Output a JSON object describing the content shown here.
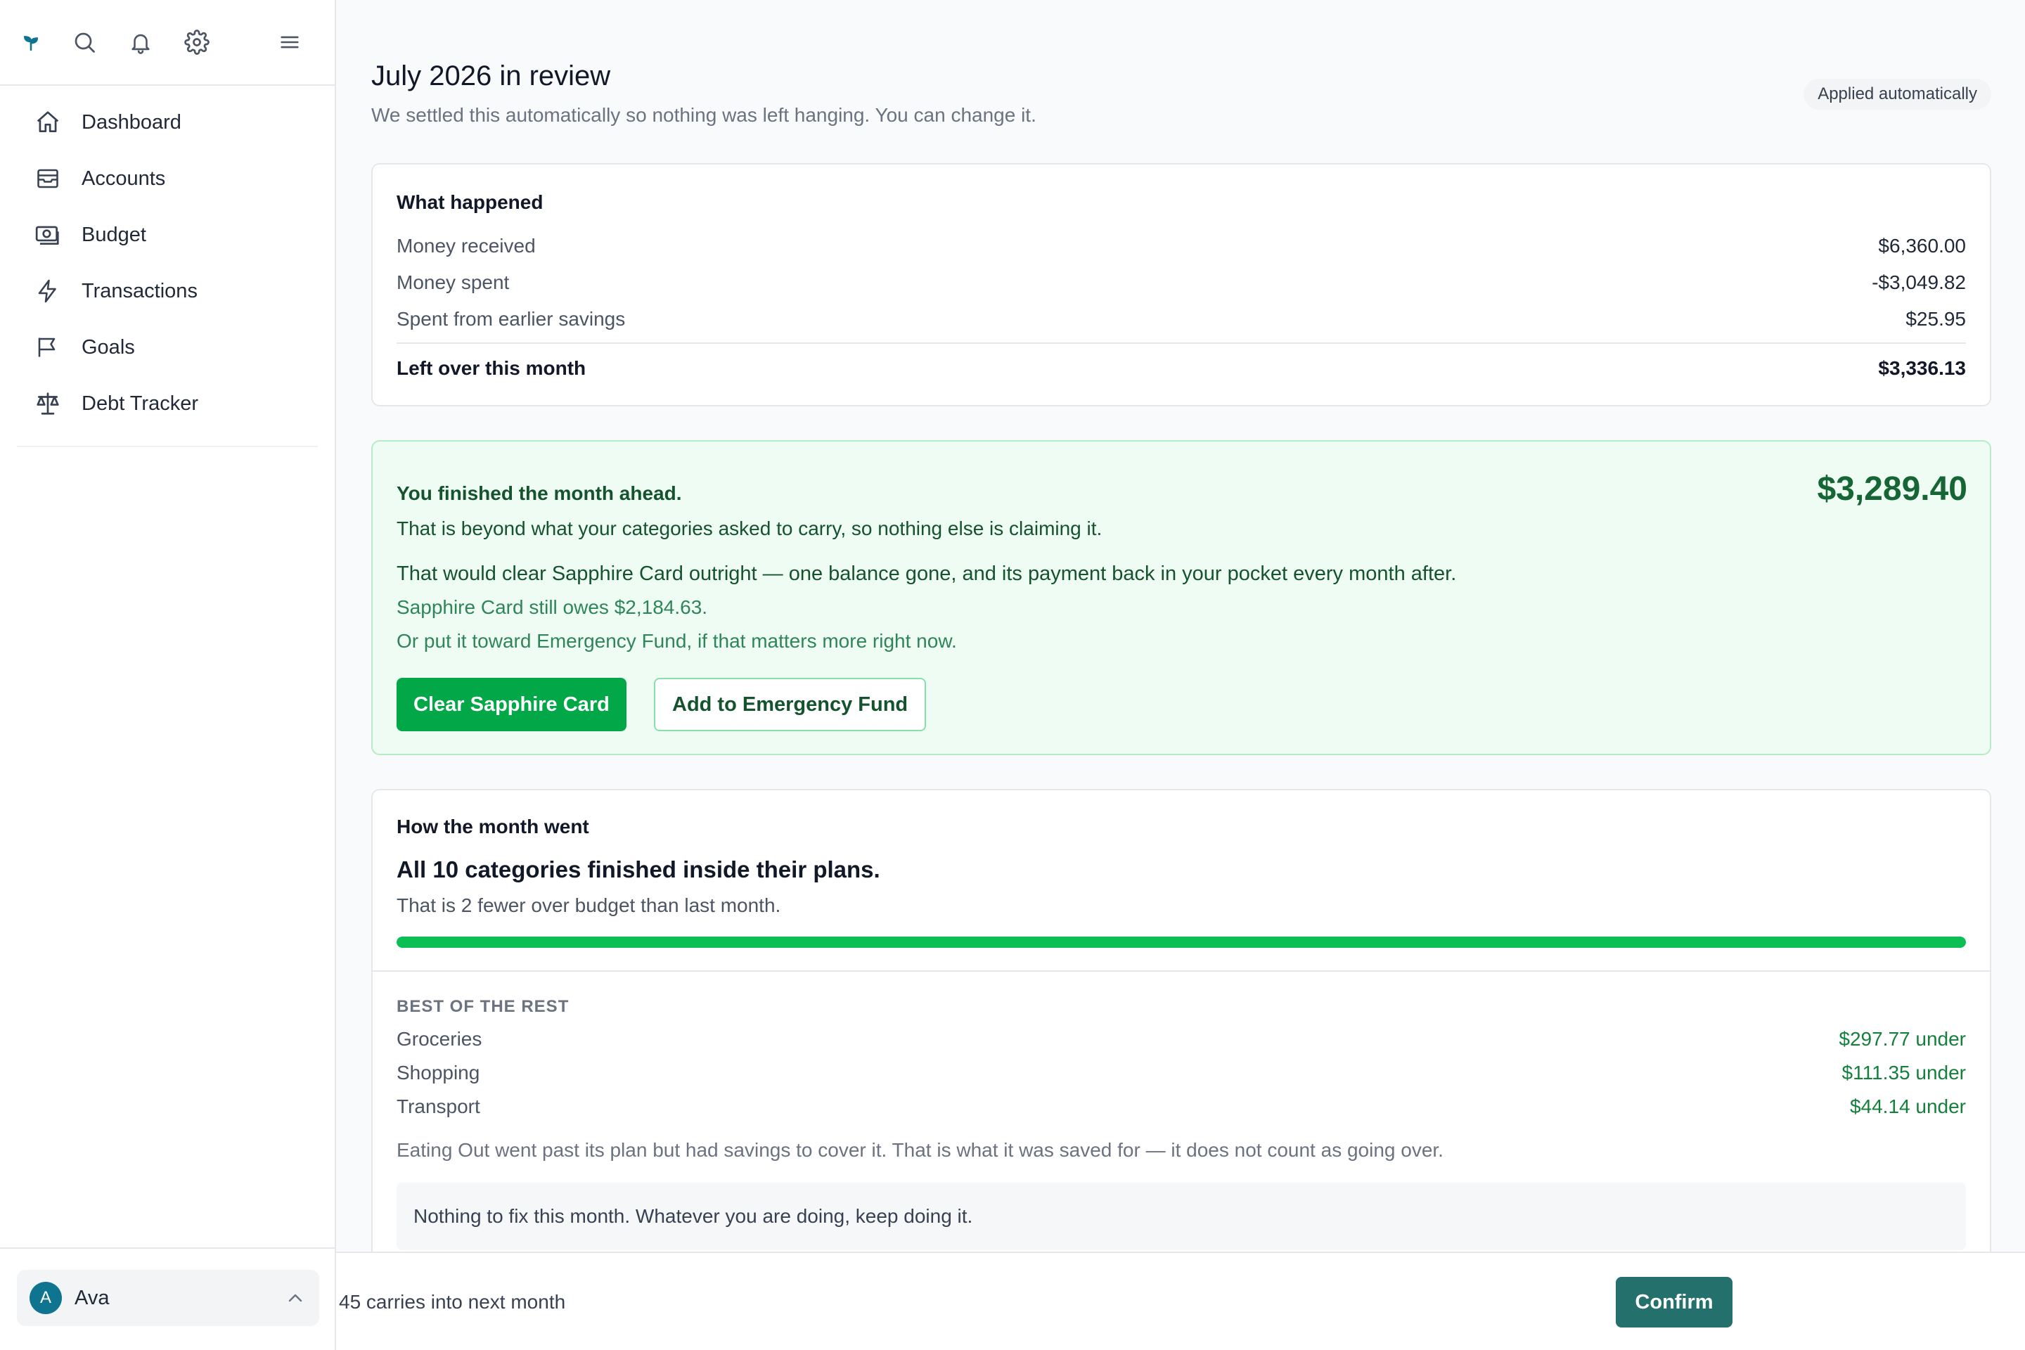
{
  "sidebar": {
    "icons": {
      "logo": "sprout-logo-icon",
      "search": "search-icon",
      "notifications": "bell-icon",
      "settings": "gear-icon",
      "menu": "hamburger-menu-icon"
    },
    "items": [
      {
        "label": "Dashboard",
        "icon": "home-icon"
      },
      {
        "label": "Accounts",
        "icon": "archive-box-icon"
      },
      {
        "label": "Budget",
        "icon": "banknote-icon"
      },
      {
        "label": "Transactions",
        "icon": "lightning-icon"
      },
      {
        "label": "Goals",
        "icon": "flag-icon"
      },
      {
        "label": "Debt Tracker",
        "icon": "scale-icon"
      }
    ],
    "user": {
      "initial": "A",
      "name": "Ava",
      "chevron": "chevron-up-icon"
    }
  },
  "header": {
    "title": "July 2026 in review",
    "subtitle": "We settled this automatically so nothing was left hanging. You can change it.",
    "badge": "Applied automatically"
  },
  "what_happened": {
    "title": "What happened",
    "rows": [
      {
        "label": "Money received",
        "value": "$6,360.00"
      },
      {
        "label": "Money spent",
        "value": "-$3,049.82"
      },
      {
        "label": "Spent from earlier savings",
        "value": "$25.95"
      }
    ],
    "total": {
      "label": "Left over this month",
      "value": "$3,336.13"
    }
  },
  "surplus": {
    "headline": "You finished the month ahead.",
    "amount": "$3,289.40",
    "line1": "That is beyond what your categories asked to carry, so nothing else is claiming it.",
    "line2": "That would clear Sapphire Card outright — one balance gone, and its payment back in your pocket every month after.",
    "line3": "Sapphire Card still owes $2,184.63.",
    "line4": "Or put it toward Emergency Fund, if that matters more right now.",
    "primary_button": "Clear Sapphire Card",
    "secondary_button": "Add to Emergency Fund",
    "colors": {
      "background": "#effcf3",
      "primary": "#02a748",
      "text": "#14532d"
    }
  },
  "month_summary": {
    "title": "How the month went",
    "headline": "All 10 categories finished inside their plans.",
    "subline": "That is 2 fewer over budget than last month.",
    "progress_percent": 100,
    "best_title": "BEST OF THE REST",
    "best": [
      {
        "label": "Groceries",
        "value": "$297.77 under"
      },
      {
        "label": "Shopping",
        "value": "$111.35 under"
      },
      {
        "label": "Transport",
        "value": "$44.14 under"
      }
    ],
    "note": "Eating Out went past its plan but had savings to cover it. That is what it was saved for — it does not count as going over.",
    "info": "Nothing to fix this month. Whatever you are doing, keep doing it."
  },
  "footer": {
    "carry_text": "45 carries into next month",
    "confirm": "Confirm",
    "confirm_color": "#23706c"
  }
}
